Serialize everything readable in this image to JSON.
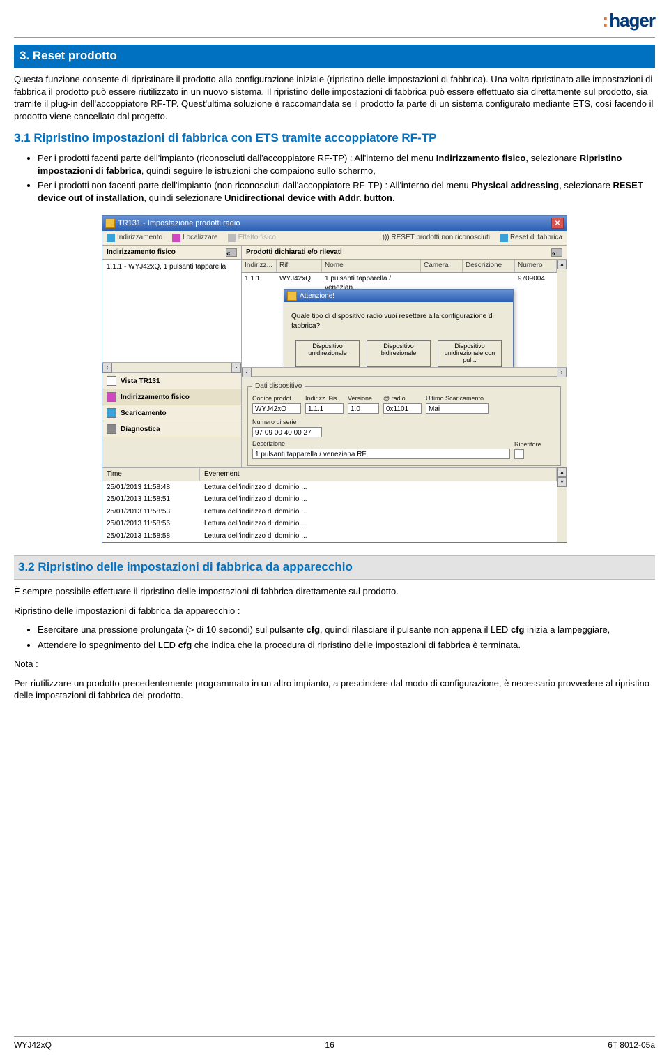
{
  "logo": "hager",
  "section3": {
    "title": "3. Reset prodotto",
    "intro": "Questa funzione consente di ripristinare il prodotto alla configurazione iniziale (ripristino delle impostazioni di fabbrica). Una volta ripristinato alle impostazioni di fabbrica il prodotto può essere riutilizzato in un nuovo sistema. Il ripristino delle impostazioni di fabbrica può essere effettuato sia direttamente sul prodotto, sia tramite il plug-in dell'accoppiatore RF-TP. Quest'ultima soluzione è raccomandata se il prodotto fa parte di un sistema configurato mediante ETS, così facendo il prodotto viene cancellato dal progetto."
  },
  "section31": {
    "title": "3.1 Ripristino impostazioni di fabbrica con ETS tramite accoppiatore RF-TP",
    "li1_a": "Per i prodotti facenti parte dell'impianto (riconosciuti dall'accoppiatore RF-TP) : All'interno del menu ",
    "li1_b1": "Indirizzamento fisico",
    "li1_c": ", selezionare ",
    "li1_b2": "Ripristino impostazioni di fabbrica",
    "li1_d": ", quindi seguire le istruzioni che compaiono sullo schermo,",
    "li2_a": "Per i prodotti non facenti parte dell'impianto (non riconosciuti dall'accoppiatore RF-TP) : All'interno del menu ",
    "li2_b1": "Physical addressing",
    "li2_c": ", selezionare ",
    "li2_b2": "RESET device out of installation",
    "li2_d": ", quindi selezionare ",
    "li2_b3": "Unidirectional device with Addr. button",
    "li2_e": "."
  },
  "window": {
    "title": "TR131 - Impostazione prodotti radio",
    "toolbar": {
      "indirizzamento": "Indirizzamento",
      "localizzare": "Localizzare",
      "effetto": "Effetto fisico",
      "reset": "))) RESET prodotti non riconosciuti",
      "factory": "Reset di fabbrica"
    },
    "left": {
      "head": "Indirizzamento fisico",
      "tree_item": "1.1.1 - WYJ42xQ, 1 pulsanti tapparella",
      "acc_vista": "Vista TR131",
      "acc_ind": "Indirizzamento fisico",
      "acc_scar": "Scaricamento",
      "acc_diag": "Diagnostica"
    },
    "right": {
      "head": "Prodotti dichiarati e/o rilevati",
      "cols": [
        "Indirizz...",
        "Rif.",
        "Nome",
        "Camera",
        "Descrizione",
        "Numero"
      ],
      "row": [
        "1.1.1",
        "WYJ42xQ",
        "1 pulsanti tapparella / venezian...",
        "",
        "",
        "9709004"
      ]
    },
    "modal": {
      "title": "Attenzione!",
      "question": "Quale tipo di dispositivo radio vuoi resettare alla configurazione di fabbrica?",
      "btn1": "Dispositivo unidirezionale",
      "btn2": "Dispositivo bidirezionale",
      "btn3": "Dispositivo unidirezionale con pul..."
    },
    "dati": {
      "legend": "Dati dispositivo",
      "labels": [
        "Codice prodot",
        "Indirizz. Fis.",
        "Versione",
        "@ radio",
        "Ultimo Scaricamento",
        "Numero di serie",
        "Descrizione",
        "Ripetitore"
      ],
      "vals": [
        "WYJ42xQ",
        "1.1.1",
        "1.0",
        "0x1101",
        "Mai",
        "97 09 00 40 00 27",
        "1 pulsanti tapparella / veneziana RF"
      ]
    },
    "log": {
      "cols": [
        "Time",
        "Evenement"
      ],
      "rows": [
        [
          "25/01/2013 11:58:48",
          "Lettura dell'indirizzo di dominio ..."
        ],
        [
          "25/01/2013 11:58:51",
          "Lettura dell'indirizzo di dominio ..."
        ],
        [
          "25/01/2013 11:58:53",
          "Lettura dell'indirizzo di dominio ..."
        ],
        [
          "25/01/2013 11:58:56",
          "Lettura dell'indirizzo di dominio ..."
        ],
        [
          "25/01/2013 11:58:58",
          "Lettura dell'indirizzo di dominio ..."
        ]
      ]
    }
  },
  "section32": {
    "title": "3.2 Ripristino delle impostazioni di fabbrica da apparecchio",
    "p1": "È sempre possibile effettuare il ripristino delle impostazioni di fabbrica direttamente sul prodotto.",
    "p2": "Ripristino delle impostazioni di fabbrica da apparecchio :",
    "li1_a": "Esercitare una pressione prolungata (> di 10 secondi) sul pulsante ",
    "li1_b1": "cfg",
    "li1_c": ", quindi rilasciare il pulsante non appena il LED ",
    "li1_b2": "cfg",
    "li1_d": " inizia a lampeggiare,",
    "li2_a": "Attendere lo spegnimento del LED ",
    "li2_b1": "cfg",
    "li2_c": " che indica che la procedura di ripristino delle impostazioni di fabbrica è terminata.",
    "note_label": "Nota :",
    "note": "Per riutilizzare un prodotto precedentemente programmato in un altro impianto, a prescindere dal modo di configurazione, è necessario provvedere al ripristino delle impostazioni di fabbrica del prodotto."
  },
  "footer": {
    "left": "WYJ42xQ",
    "center": "16",
    "right": "6T 8012-05a"
  }
}
